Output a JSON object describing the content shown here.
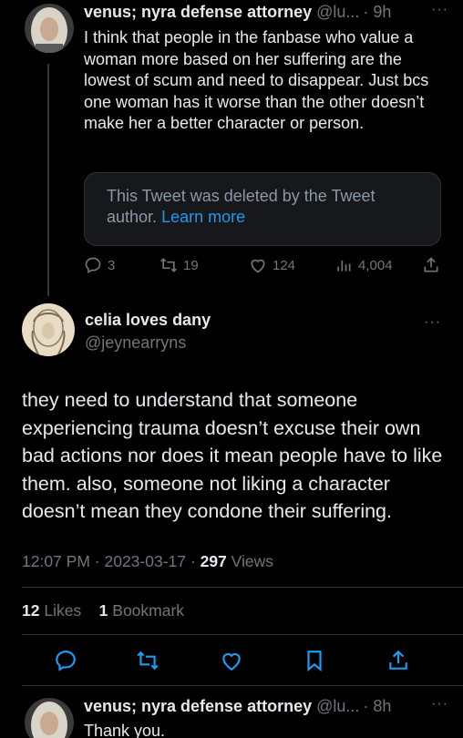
{
  "tweet1": {
    "name": "venus; nyra defense attorney",
    "handle": "@lu...",
    "time": "· 9h",
    "more": "···",
    "text": "I think that people in the fanbase who value a woman more based on her suffering are the lowest of scum and need to disappear. Just bcs one woman has it worse than the other doesn’t make her a better character or person.",
    "deleted_text": "This Tweet was deleted by the Tweet author.",
    "deleted_link": "Learn more",
    "replies": "3",
    "retweets": "19",
    "likes": "124",
    "views": "4,004"
  },
  "tweet2": {
    "name": "celia loves dany",
    "handle": "@jeynearryns",
    "more": "···",
    "text": "they need to understand that someone experiencing trauma doesn’t excuse their own bad actions nor does it mean people have to like them. also, someone not liking a character doesn’t mean they condone their suffering.",
    "time": "12:07 PM",
    "date": "2023-03-17",
    "view_count": "297",
    "views_label": "Views",
    "likes_count": "12",
    "likes_label": "Likes",
    "bookmarks_count": "1",
    "bookmarks_label": "Bookmark"
  },
  "tweet3": {
    "name": "venus; nyra defense attorney",
    "handle": "@lu...",
    "time": "· 8h",
    "more": "···",
    "text": "Thank you."
  },
  "colors": {
    "background": "#000000",
    "text": "#e7e9ea",
    "muted": "#71767b",
    "link": "#1d9bf0",
    "border": "#2f3336"
  },
  "icons": [
    "reply-icon",
    "retweet-icon",
    "like-icon",
    "views-icon",
    "share-icon",
    "bookmark-icon",
    "more-icon"
  ]
}
